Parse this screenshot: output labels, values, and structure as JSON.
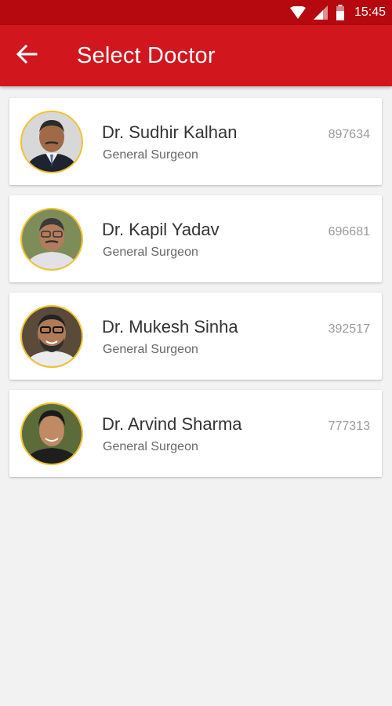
{
  "status_bar": {
    "time": "15:45",
    "icons": [
      "wifi-icon",
      "signal-icon",
      "battery-icon"
    ]
  },
  "app_bar": {
    "title": "Select Doctor",
    "back_icon": "arrow-left-icon"
  },
  "colors": {
    "status_bar": "#b5080f",
    "app_bar": "#d2161e",
    "avatar_ring": "#f2c227",
    "background": "#f2f2f2"
  },
  "doctors": [
    {
      "name": "Dr. Sudhir Kalhan",
      "specialty": "General Surgeon",
      "code": "897634"
    },
    {
      "name": "Dr. Kapil Yadav",
      "specialty": "General Surgeon",
      "code": "696681"
    },
    {
      "name": "Dr. Mukesh Sinha",
      "specialty": "General Surgeon",
      "code": "392517"
    },
    {
      "name": "Dr. Arvind Sharma",
      "specialty": "General Surgeon",
      "code": "777313"
    }
  ]
}
